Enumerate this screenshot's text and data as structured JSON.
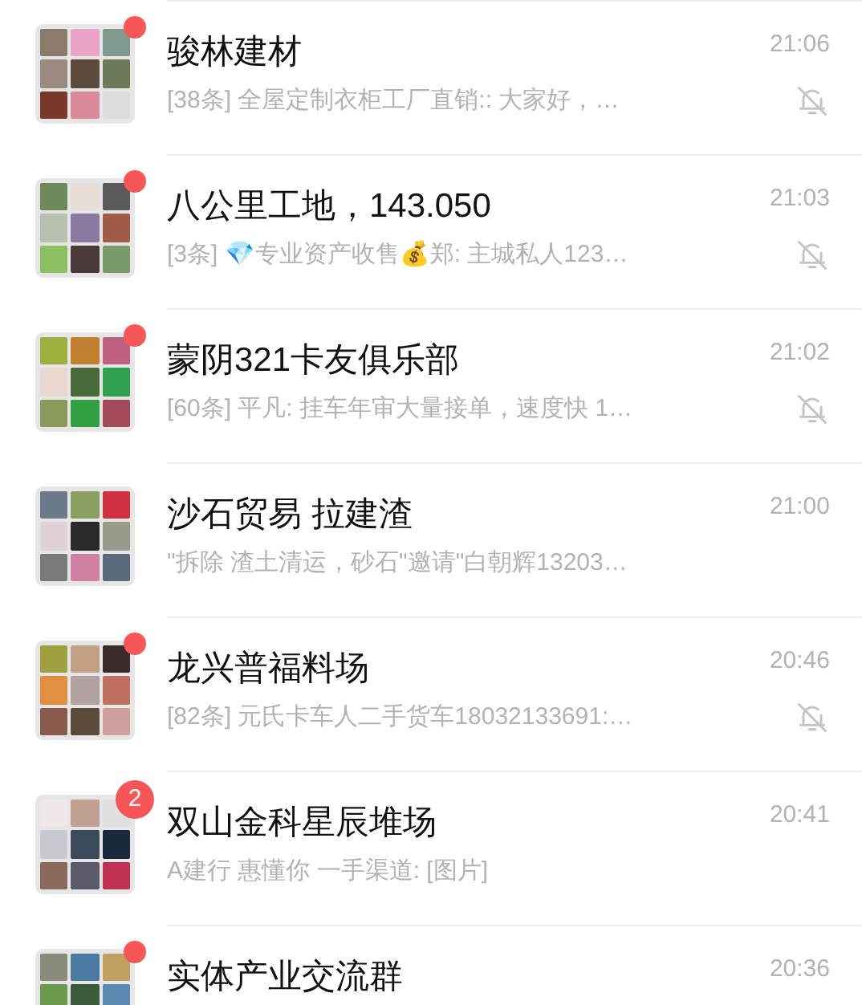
{
  "chats": [
    {
      "name": "骏林建材",
      "time": "21:06",
      "preview": "[38条] 全屋定制衣柜工厂直销:: 大家好，…",
      "muted": true,
      "badge": {
        "kind": "dot"
      }
    },
    {
      "name": "八公里工地，143.050",
      "time": "21:03",
      "preview": "[3条] 💎专业资产收售💰郑: 主城私人123…",
      "muted": true,
      "badge": {
        "kind": "dot"
      }
    },
    {
      "name": "蒙阴321卡友俱乐部",
      "time": "21:02",
      "preview": "[60条] 平凡: 挂车年审大量接单，速度快  1…",
      "muted": true,
      "badge": {
        "kind": "dot"
      }
    },
    {
      "name": "沙石贸易 拉建渣",
      "time": "21:00",
      "preview": "\"拆除 渣土清运，砂石\"邀请\"白朝辉13203…",
      "muted": false,
      "badge": {
        "kind": "none"
      }
    },
    {
      "name": "龙兴普福料场",
      "time": "20:46",
      "preview": "[82条] 元氏卡车人二手货车18032133691:…",
      "muted": true,
      "badge": {
        "kind": "dot"
      }
    },
    {
      "name": "双山金科星辰堆场",
      "time": "20:41",
      "preview": "A建行  惠懂你  一手渠道: [图片]",
      "muted": false,
      "badge": {
        "kind": "count",
        "text": "2"
      }
    },
    {
      "name": "实体产业交流群",
      "time": "20:36",
      "badge": {
        "kind": "dot"
      }
    }
  ]
}
